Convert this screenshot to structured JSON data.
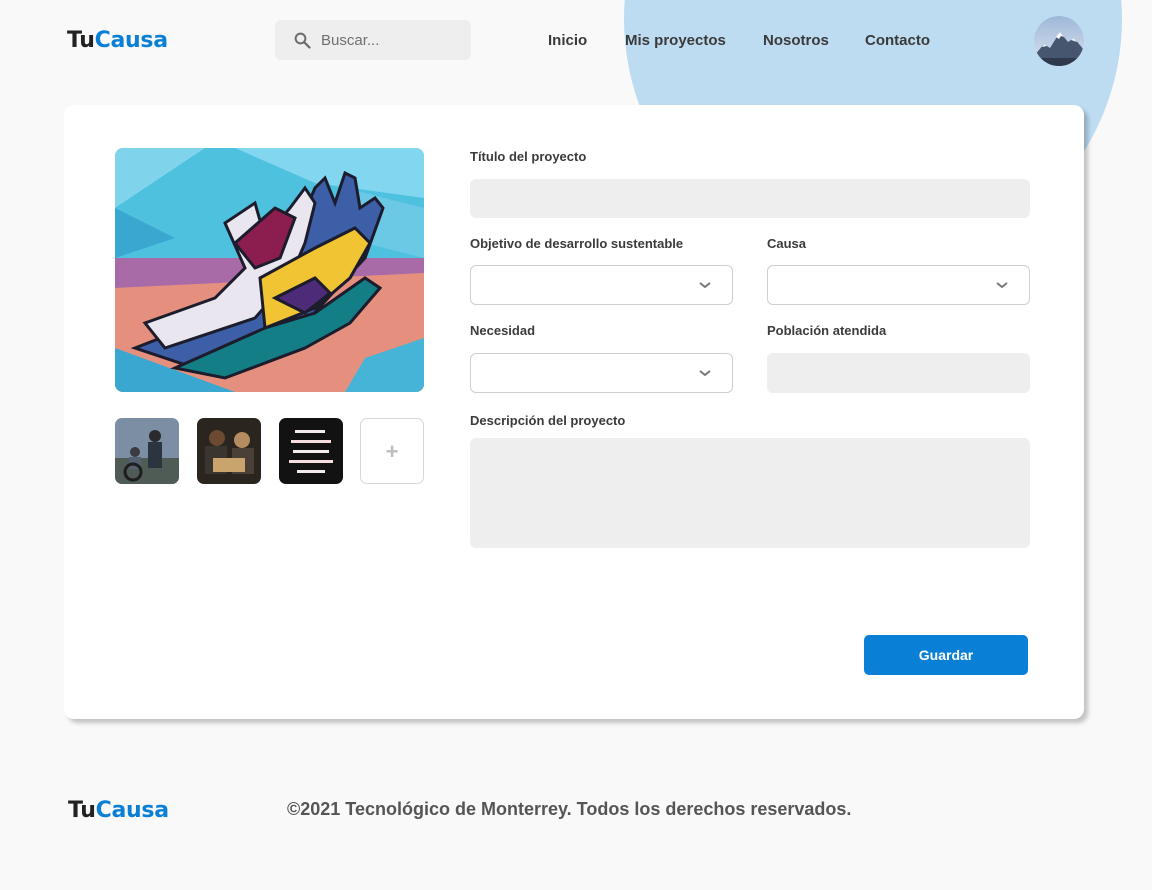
{
  "header": {
    "logo": {
      "part1": "Tu",
      "part2": "Causa"
    },
    "search": {
      "placeholder": "Buscar...",
      "value": ""
    },
    "nav": [
      {
        "label": "Inicio"
      },
      {
        "label": "Mis proyectos"
      },
      {
        "label": "Nosotros"
      },
      {
        "label": "Contacto"
      }
    ],
    "avatar_icon": "user-avatar-mountain"
  },
  "project_form": {
    "main_image_icon": "mural-hands-image",
    "thumbnails": [
      {
        "icon": "wheelchair-photo"
      },
      {
        "icon": "people-sign-photo"
      },
      {
        "icon": "neon-sign-photo"
      }
    ],
    "add_image_label": "+",
    "fields": {
      "title": {
        "label": "Título del proyecto",
        "value": ""
      },
      "ods": {
        "label": "Objetivo de desarrollo sustentable",
        "value": ""
      },
      "cause": {
        "label": "Causa",
        "value": ""
      },
      "need": {
        "label": "Necesidad",
        "value": ""
      },
      "population": {
        "label": "Población atendida",
        "value": ""
      },
      "description": {
        "label": "Descripción del proyecto",
        "value": ""
      }
    },
    "save_label": "Guardar"
  },
  "footer": {
    "logo": {
      "part1": "Tu",
      "part2": "Causa"
    },
    "copyright": "©2021 Tecnológico de Monterrey. Todos los derechos reservados."
  },
  "colors": {
    "accent": "#0a7fd6",
    "background": "#f9f9f9",
    "decor_circle": "#bddcf2",
    "field_bg": "#eeeeee"
  }
}
